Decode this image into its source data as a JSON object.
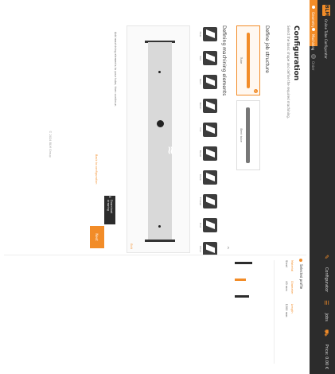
{
  "header": {
    "brand_logo": "BLM",
    "brand_text": "Online Tube Configurator",
    "actions": [
      "Configurator",
      "Jobs",
      "Price: 0.00 €"
    ]
  },
  "steps": [
    {
      "label": "Geometry",
      "active": true
    },
    {
      "label": "Machining",
      "active": true
    },
    {
      "label": "Order",
      "active": false
    }
  ],
  "page": {
    "title": "Configuration",
    "subtitle": "Select the basic shape and define the required machining."
  },
  "sections": {
    "job_structure": "Define job structure",
    "machining": "Defining machining elements"
  },
  "job_cards": [
    {
      "label": "Tube",
      "selected": true
    },
    {
      "label": "Bent tube",
      "selected": false
    }
  ],
  "elements": [
    {
      "label": "Hole"
    },
    {
      "label": "Slot"
    },
    {
      "label": "Rect."
    },
    {
      "label": "Notch"
    },
    {
      "label": "Cut"
    },
    {
      "label": "Bevel"
    },
    {
      "label": "Mark"
    },
    {
      "label": "Thread"
    },
    {
      "label": "End"
    },
    {
      "label": "Other"
    }
  ],
  "preview": {
    "note": "Edit"
  },
  "actions": {
    "info": "Add machining elements to your tube, then continue.",
    "download": "Download drawing",
    "next": "Next",
    "back": "Back to configuration"
  },
  "footer": "© 2024 BLM Group",
  "summary": {
    "heading": "Selected profile",
    "cols": [
      {
        "label": "Material",
        "value": "Steel"
      },
      {
        "label": "Diameter",
        "value": "40 mm"
      },
      {
        "label": "Length",
        "value": "1200 mm"
      }
    ]
  },
  "colors": {
    "accent": "#f28c28",
    "dark": "#2c2c2c"
  }
}
